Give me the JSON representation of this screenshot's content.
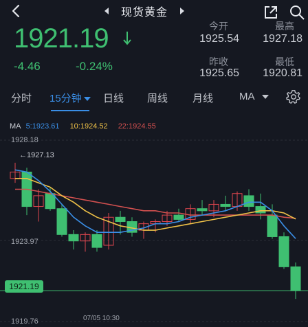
{
  "header": {
    "title": "现货黄金"
  },
  "quote": {
    "price": "1921.19",
    "change": "-4.46",
    "change_pct": "-0.24%",
    "open_label": "今开",
    "open": "1925.54",
    "high_label": "最高",
    "high": "1927.18",
    "prev_close_label": "昨收",
    "prev_close": "1925.65",
    "low_label": "最低",
    "low": "1920.81"
  },
  "tabs": [
    {
      "label": "分时"
    },
    {
      "label": "15分钟"
    },
    {
      "label": "日线"
    },
    {
      "label": "周线"
    },
    {
      "label": "月线"
    },
    {
      "label": "MA"
    }
  ],
  "ma_legend": {
    "ma_label": "MA",
    "ma5": "5:1923.61",
    "ma10": "10:1924.52",
    "ma22": "22:1924.55"
  },
  "colors": {
    "up": "#3fbf71",
    "down": "#e0464e",
    "ma5": "#3a8ee6",
    "ma10": "#f0c248",
    "ma22": "#d2504f",
    "accent": "#3a8ee6"
  },
  "chart": {
    "y_top_label": "1928.18",
    "y_mid_label": "1923.97",
    "y_bottom_label": "1919.76",
    "high_marker": "1927.13",
    "current_label": "1921.19",
    "time_label": "07/05 10:30"
  },
  "chart_data": {
    "type": "candlestick",
    "ylim": [
      1919.76,
      1928.18
    ],
    "candles": [
      {
        "o": 1926.4,
        "h": 1927.13,
        "l": 1926.2,
        "c": 1926.7
      },
      {
        "o": 1926.7,
        "h": 1926.9,
        "l": 1924.7,
        "c": 1925.1
      },
      {
        "o": 1925.1,
        "h": 1925.9,
        "l": 1924.4,
        "c": 1925.6
      },
      {
        "o": 1925.7,
        "h": 1926.0,
        "l": 1924.9,
        "c": 1925.0
      },
      {
        "o": 1925.0,
        "h": 1925.2,
        "l": 1923.7,
        "c": 1923.8
      },
      {
        "o": 1923.8,
        "h": 1924.0,
        "l": 1923.1,
        "c": 1923.5
      },
      {
        "o": 1923.5,
        "h": 1923.9,
        "l": 1923.0,
        "c": 1923.8
      },
      {
        "o": 1923.8,
        "h": 1924.0,
        "l": 1923.0,
        "c": 1923.2
      },
      {
        "o": 1923.3,
        "h": 1924.8,
        "l": 1923.1,
        "c": 1924.6
      },
      {
        "o": 1924.6,
        "h": 1924.9,
        "l": 1923.8,
        "c": 1924.4
      },
      {
        "o": 1924.4,
        "h": 1924.6,
        "l": 1923.7,
        "c": 1923.9
      },
      {
        "o": 1924.0,
        "h": 1924.4,
        "l": 1923.6,
        "c": 1924.3
      },
      {
        "o": 1924.3,
        "h": 1924.5,
        "l": 1923.9,
        "c": 1924.4
      },
      {
        "o": 1924.4,
        "h": 1924.9,
        "l": 1924.2,
        "c": 1924.7
      },
      {
        "o": 1924.7,
        "h": 1925.0,
        "l": 1924.4,
        "c": 1924.5
      },
      {
        "o": 1924.5,
        "h": 1925.2,
        "l": 1924.3,
        "c": 1925.0
      },
      {
        "o": 1925.0,
        "h": 1925.4,
        "l": 1924.7,
        "c": 1924.9
      },
      {
        "o": 1924.9,
        "h": 1925.4,
        "l": 1924.6,
        "c": 1925.2
      },
      {
        "o": 1925.2,
        "h": 1925.6,
        "l": 1924.9,
        "c": 1925.1
      },
      {
        "o": 1925.1,
        "h": 1925.8,
        "l": 1924.9,
        "c": 1925.7
      },
      {
        "o": 1925.6,
        "h": 1925.9,
        "l": 1924.9,
        "c": 1925.1
      },
      {
        "o": 1925.1,
        "h": 1925.7,
        "l": 1924.5,
        "c": 1924.8
      },
      {
        "o": 1924.7,
        "h": 1925.2,
        "l": 1923.6,
        "c": 1923.7
      },
      {
        "o": 1923.7,
        "h": 1923.9,
        "l": 1922.2,
        "c": 1922.3
      },
      {
        "o": 1922.3,
        "h": 1922.5,
        "l": 1920.81,
        "c": 1921.19
      }
    ],
    "ma5": [
      1926.8,
      1926.7,
      1926.3,
      1925.8,
      1925.2,
      1924.6,
      1924.2,
      1923.9,
      1923.9,
      1923.9,
      1924.0,
      1924.1,
      1924.3,
      1924.3,
      1924.4,
      1924.6,
      1924.7,
      1924.8,
      1924.9,
      1925.1,
      1925.3,
      1925.3,
      1924.9,
      1924.2,
      1923.61
    ],
    "ma10": [
      1926.4,
      1926.4,
      1926.2,
      1926.0,
      1925.6,
      1925.3,
      1924.9,
      1924.6,
      1924.4,
      1924.2,
      1924.1,
      1924.0,
      1924.0,
      1924.1,
      1924.2,
      1924.3,
      1924.4,
      1924.5,
      1924.6,
      1924.7,
      1924.8,
      1924.9,
      1924.9,
      1924.8,
      1924.52
    ],
    "ma22": [
      1925.9,
      1925.9,
      1925.8,
      1925.7,
      1925.6,
      1925.5,
      1925.4,
      1925.3,
      1925.2,
      1925.1,
      1925.0,
      1924.9,
      1924.9,
      1924.8,
      1924.8,
      1924.7,
      1924.7,
      1924.7,
      1924.7,
      1924.7,
      1924.7,
      1924.7,
      1924.7,
      1924.6,
      1924.55
    ]
  }
}
